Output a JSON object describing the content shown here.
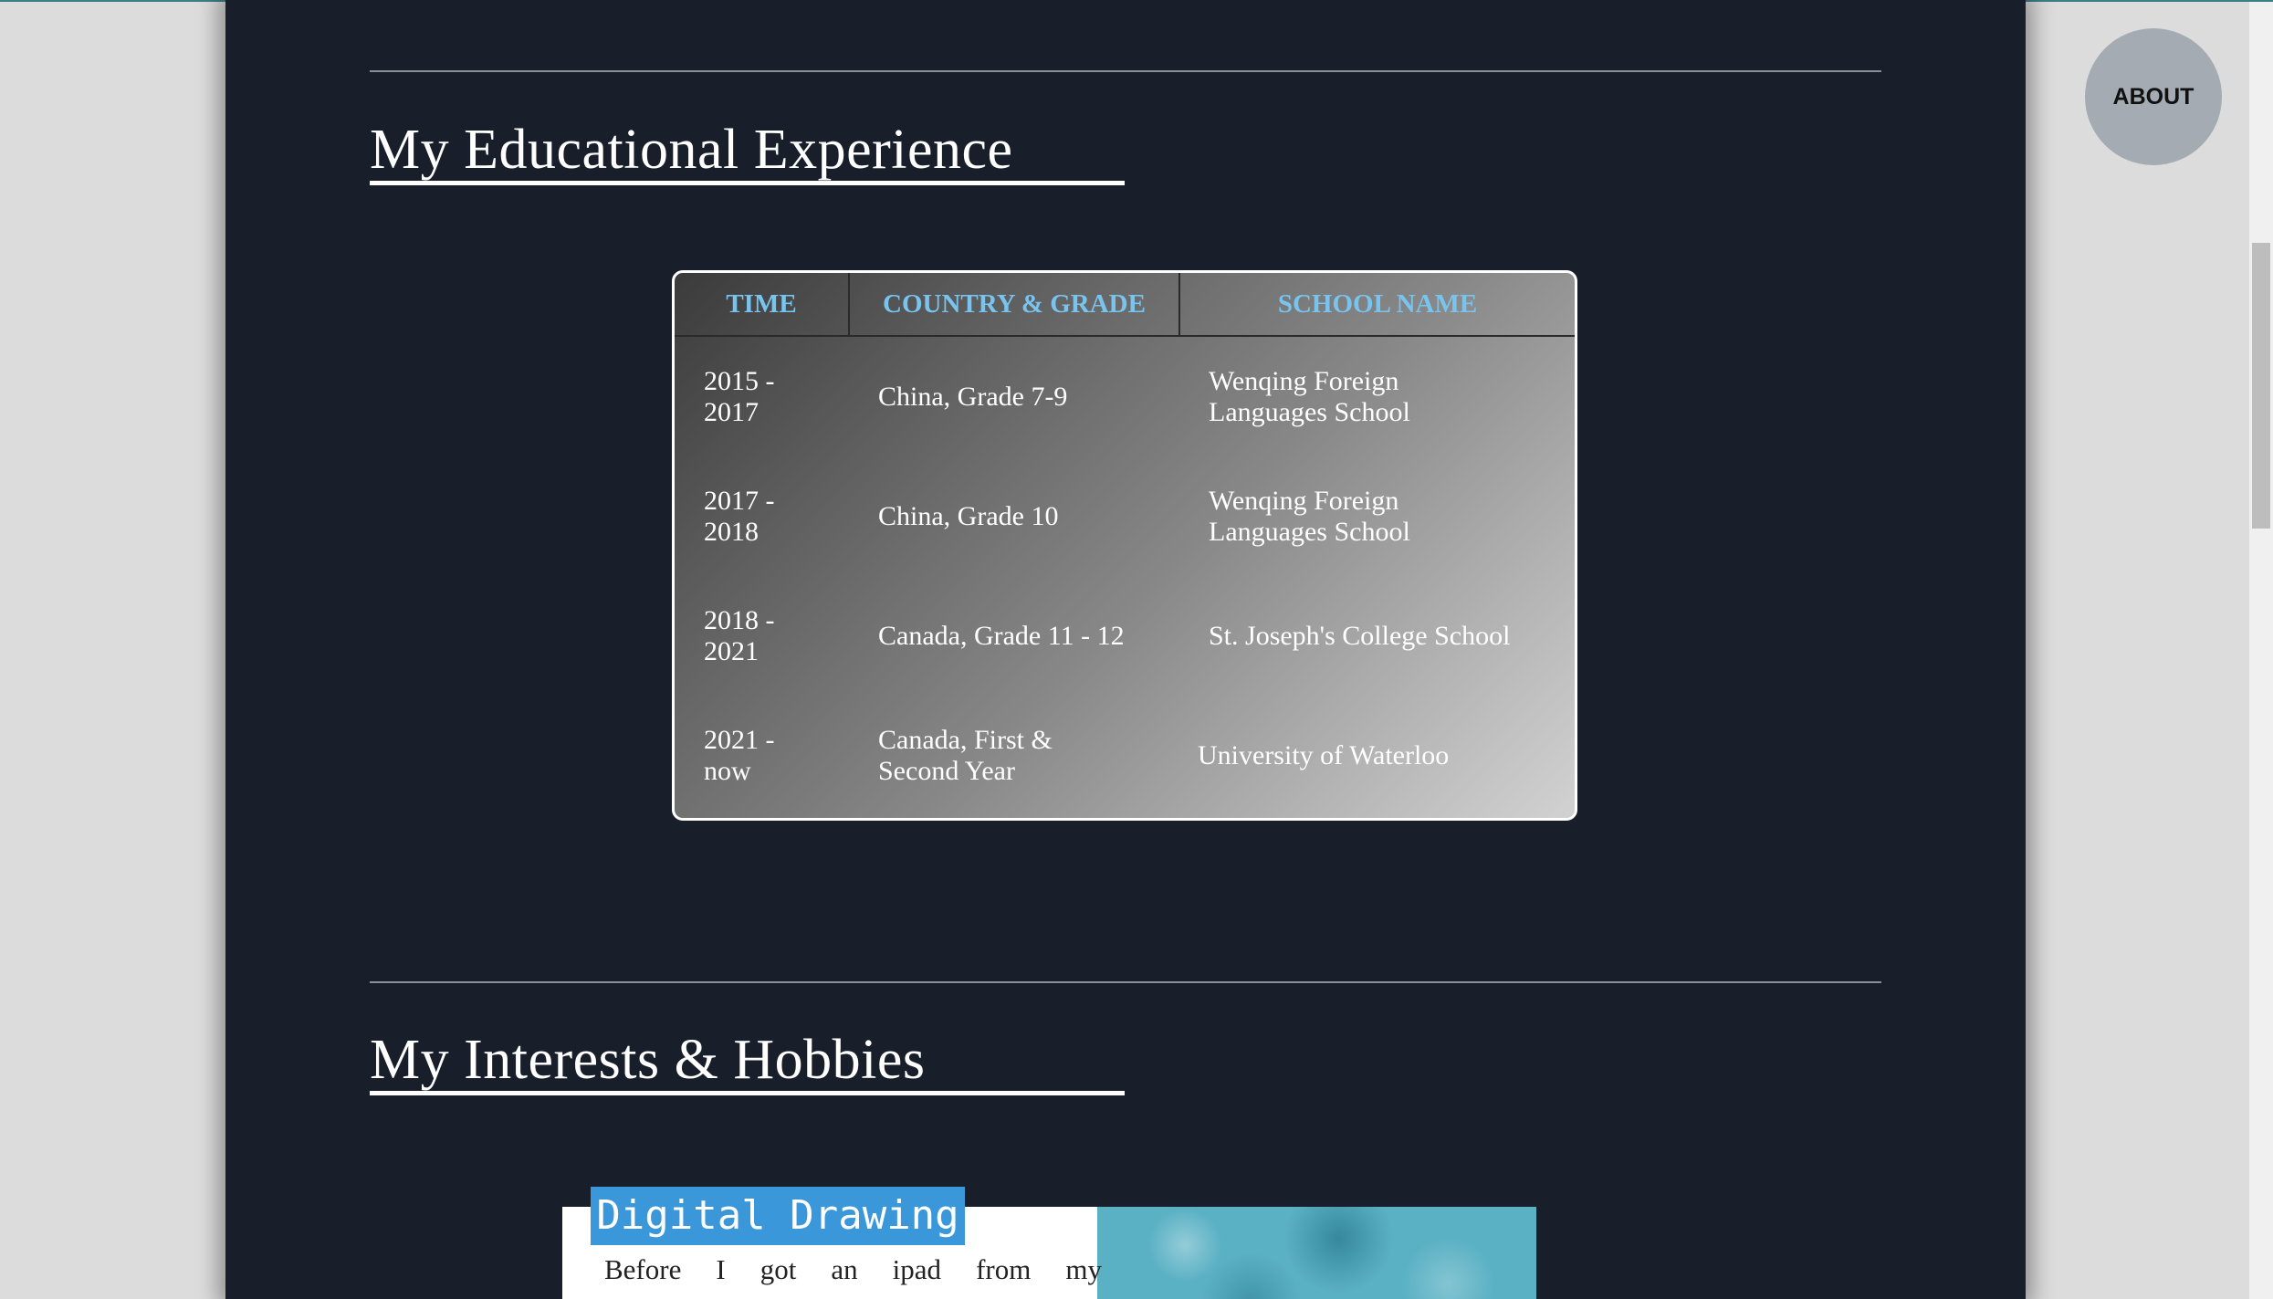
{
  "about_button": {
    "label": "ABOUT"
  },
  "education": {
    "title": "My Educational Experience",
    "headers": [
      "TIME",
      "COUNTRY & GRADE",
      "SCHOOL NAME"
    ],
    "rows": [
      {
        "time_start": "2015 -",
        "time_end": "2017",
        "country": [
          "China, Grade 7-9"
        ],
        "school": [
          "Wenqing Foreign",
          "Languages School"
        ]
      },
      {
        "time_start": "2017 -",
        "time_end": "2018",
        "country": [
          "China, Grade 10"
        ],
        "school": [
          "Wenqing Foreign",
          "Languages School"
        ]
      },
      {
        "time_start": "2018 -",
        "time_end": "2021",
        "country": [
          "Canada, Grade 11 - 12"
        ],
        "school": [
          "St. Joseph's College School"
        ]
      },
      {
        "time_start": "2021 -",
        "time_end": "now",
        "country": [
          "Canada, First &",
          "Second Year"
        ],
        "school": [
          "University of Waterloo"
        ]
      }
    ]
  },
  "hobbies": {
    "title": "My Interests & Hobbies",
    "card": {
      "tag": "Digital Drawing",
      "text": "Before I got an ipad from my"
    }
  }
}
